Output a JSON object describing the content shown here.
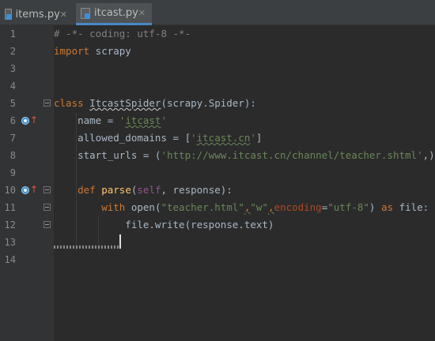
{
  "tabs": [
    {
      "label": "items.py",
      "close": "✕",
      "active": false
    },
    {
      "label": "itcast.py",
      "close": "✕",
      "active": true
    }
  ],
  "line_numbers": [
    "1",
    "2",
    "3",
    "4",
    "5",
    "6",
    "7",
    "8",
    "9",
    "10",
    "11",
    "12",
    "13",
    "14"
  ],
  "code": {
    "l1": "# -*- coding: utf-8 -*-",
    "l2_kw": "import",
    "l2_rest": " scrapy",
    "l5_kw": "class",
    "l5_name": "ItcastSpider",
    "l5_rest": "(scrapy.Spider):",
    "l6_a": "    name = ",
    "l6_q1": "'",
    "l6_str": "itcast",
    "l6_q2": "'",
    "l7_a": "    allowed_domains = [",
    "l7_q1": "'",
    "l7_str": "itcast.cn",
    "l7_q2": "'",
    "l7_b": "]",
    "l8_a": "    start_urls = (",
    "l8_str": "'http://www.itcast.cn/channel/teacher.shtml'",
    "l8_b": ",)",
    "l10_kw": "    def ",
    "l10_fn": "parse",
    "l10_p1": "(",
    "l10_self": "self",
    "l10_p2": ", response):",
    "l11_kw": "        with ",
    "l11_a": "open(",
    "l11_s1": "\"teacher.html\"",
    "l11_c1": ",",
    "l11_s2": "\"w\"",
    "l11_c2": ",",
    "l11_param": "encoding",
    "l11_eq": "=",
    "l11_s3": "\"utf-8\"",
    "l11_b": ") ",
    "l11_kw2": "as",
    "l11_c": " file:",
    "l12": "            file.write(response.text)"
  },
  "colors": {
    "background": "#2b2b2b",
    "gutter": "#313335",
    "keyword": "#cc7832",
    "string": "#6a8759",
    "comment": "#808080",
    "function": "#ffc66d",
    "self": "#94558d",
    "param": "#aa4926",
    "text": "#a9b7c6",
    "tab_active_underline": "#4a88c7"
  },
  "icons": {
    "file": "python-file-icon",
    "override": "override-method-icon",
    "fold": "fold-marker-icon"
  }
}
